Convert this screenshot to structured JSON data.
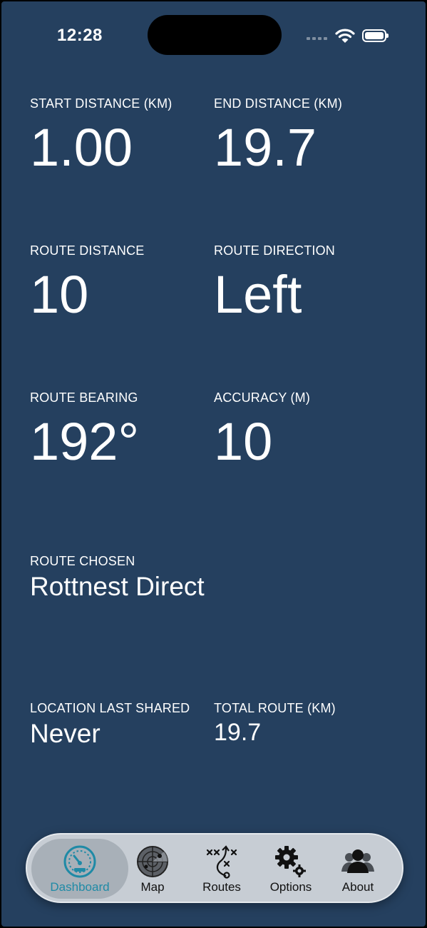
{
  "status_bar": {
    "time": "12:28"
  },
  "stats": {
    "start_distance": {
      "label": "START DISTANCE (KM)",
      "value": "1.00"
    },
    "end_distance": {
      "label": "END DISTANCE (KM)",
      "value": "19.7"
    },
    "route_distance": {
      "label": "ROUTE DISTANCE",
      "value": "10"
    },
    "route_direction": {
      "label": "ROUTE DIRECTION",
      "value": "Left"
    },
    "route_bearing": {
      "label": "ROUTE BEARING",
      "value": "192°"
    },
    "accuracy": {
      "label": "ACCURACY (M)",
      "value": "10"
    },
    "route_chosen": {
      "label": "ROUTE CHOSEN",
      "value": "Rottnest Direct"
    },
    "location_last_shared": {
      "label": "LOCATION LAST SHARED",
      "value": "Never"
    },
    "total_route": {
      "label": "TOTAL ROUTE (KM)",
      "value": "19.7"
    }
  },
  "tabbar": {
    "active_color": "#1f8aa6",
    "items": [
      {
        "label": "Dashboard",
        "icon": "speedometer-icon"
      },
      {
        "label": "Map",
        "icon": "radar-icon"
      },
      {
        "label": "Routes",
        "icon": "route-plan-icon"
      },
      {
        "label": "Options",
        "icon": "gears-icon"
      },
      {
        "label": "About",
        "icon": "people-icon"
      }
    ]
  },
  "colors": {
    "background": "#25405f",
    "tabbar": "#c7cdd4"
  }
}
